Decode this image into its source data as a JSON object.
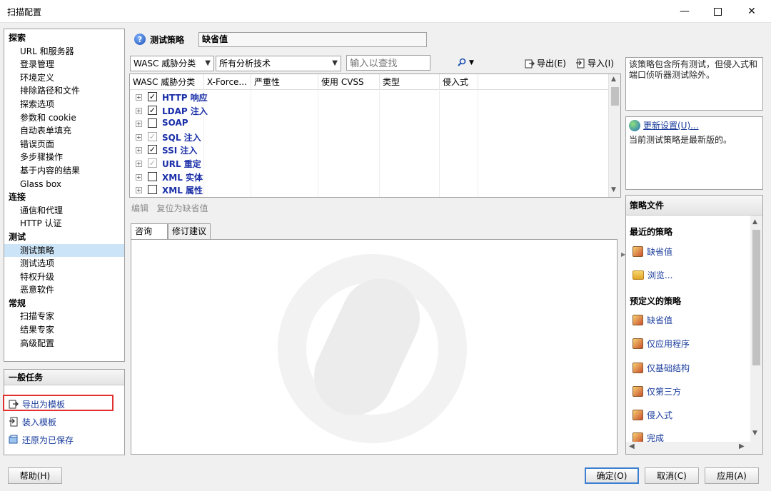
{
  "window": {
    "title": "扫描配置"
  },
  "nav": {
    "groups": [
      {
        "label": "探索",
        "items": [
          "URL 和服务器",
          "登录管理",
          "环境定义",
          "排除路径和文件",
          "探索选项",
          "参数和 cookie",
          "自动表单填充",
          "错误页面",
          "多步骤操作",
          "基于内容的结果",
          "Glass box"
        ]
      },
      {
        "label": "连接",
        "items": [
          "通信和代理",
          "HTTP 认证"
        ]
      },
      {
        "label": "测试",
        "items": [
          "测试策略",
          "测试选项",
          "特权升级",
          "恶意软件"
        ]
      },
      {
        "label": "常规",
        "items": [
          "扫描专家",
          "结果专家",
          "高级配置"
        ]
      }
    ],
    "selected": "测试策略"
  },
  "tasks": {
    "title": "一般任务",
    "items": [
      {
        "label": "导出为模板",
        "icon": "export-icon"
      },
      {
        "label": "装入模板",
        "icon": "import-icon"
      },
      {
        "label": "还原为已保存",
        "icon": "restore-icon"
      }
    ]
  },
  "header": {
    "label": "测试策略",
    "value": "缺省值"
  },
  "toolbar": {
    "category_combo": "WASC 威胁分类",
    "technique_combo": "所有分析技术",
    "search_placeholder": "输入以查找",
    "export_label": "导出(E)",
    "import_label": "导入(I)"
  },
  "grid": {
    "columns": [
      "WASC 威胁分类",
      "X-Force...",
      "严重性",
      "使用 CVSS",
      "类型",
      "侵入式"
    ],
    "rows": [
      {
        "label": "HTTP 响应",
        "checked": true,
        "disabled": false
      },
      {
        "label": "LDAP 注入",
        "checked": true,
        "disabled": false
      },
      {
        "label": "SOAP",
        "checked": false,
        "disabled": false
      },
      {
        "label": "SQL 注入",
        "checked": true,
        "disabled": true
      },
      {
        "label": "SSI 注入",
        "checked": true,
        "disabled": false
      },
      {
        "label": "URL 重定",
        "checked": true,
        "disabled": true
      },
      {
        "label": "XML 实体",
        "checked": false,
        "disabled": false
      },
      {
        "label": "XML 属性",
        "checked": false,
        "disabled": false
      }
    ]
  },
  "edit_links": {
    "edit": "编辑",
    "reset": "复位为缺省值"
  },
  "tabs": [
    "咨询",
    "修订建议"
  ],
  "right": {
    "description": "该策略包含所有测试，但侵入式和端口侦听器测试除外。",
    "update_link": "更新设置(U)...",
    "update_status": "当前测试策略是最新版的。",
    "policy_files_title": "策略文件",
    "recent_title": "最近的策略",
    "recent_items": [
      "缺省值",
      "浏览..."
    ],
    "predefined_title": "预定义的策略",
    "predefined_items": [
      "缺省值",
      "仅应用程序",
      "仅基础结构",
      "仅第三方",
      "侵入式",
      "完成"
    ]
  },
  "buttons": {
    "help": "帮助(H)",
    "ok": "确定(O)",
    "cancel": "取消(C)",
    "apply": "应用(A)"
  },
  "colors": {
    "link": "#1a3c9c",
    "selection": "#cce4f7",
    "highlight_box": "#e0312f"
  }
}
